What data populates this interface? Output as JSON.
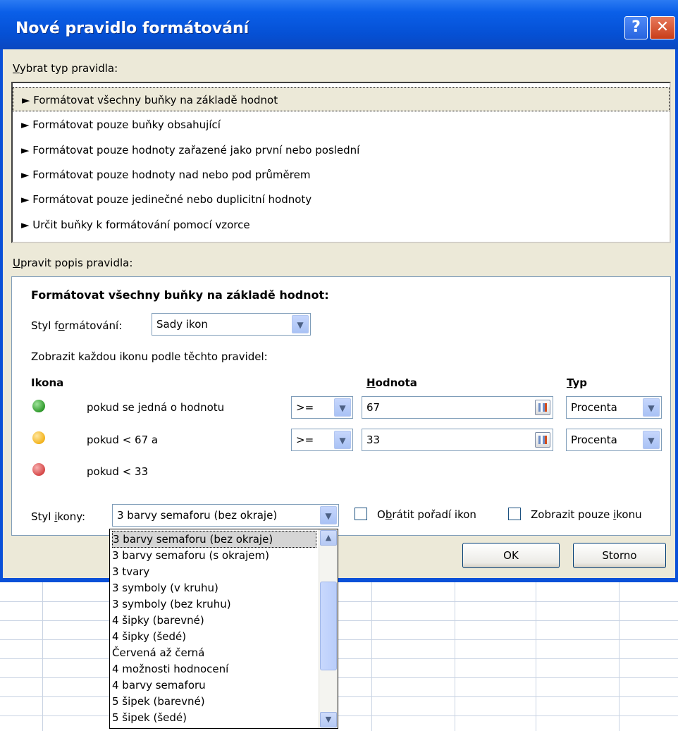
{
  "dialog": {
    "title": "Nové pravidlo formátování",
    "help_glyph": "?",
    "close_glyph": "✕"
  },
  "rule_type": {
    "label_hotkey": "V",
    "label_rest": "ybrat typ pravidla:",
    "items": [
      {
        "label": "► Formátovat všechny buňky na základě hodnot",
        "selected": true
      },
      {
        "label": "► Formátovat pouze buňky obsahující",
        "selected": false
      },
      {
        "label": "► Formátovat pouze hodnoty zařazené jako první nebo poslední",
        "selected": false
      },
      {
        "label": "► Formátovat pouze hodnoty nad nebo pod průměrem",
        "selected": false
      },
      {
        "label": "► Formátovat pouze jedinečné nebo duplicitní hodnoty",
        "selected": false
      },
      {
        "label": "► Určit buňky k formátování pomocí vzorce",
        "selected": false
      }
    ]
  },
  "rule_description": {
    "label_hotkey": "U",
    "label_rest": "pravit popis pravidla:",
    "heading": "Formátovat všechny buňky na základě hodnot:",
    "format_style_label_a": "Styl f",
    "format_style_label_hotkey": "o",
    "format_style_label_b": "rmátování:",
    "format_style_value": "Sady ikon",
    "show_each_icon": "Zobrazit každou ikonu podle těchto pravidel:",
    "col_icon": "Ikona",
    "col_value_hotkey": "H",
    "col_value_rest": "odnota",
    "col_type_hotkey": "T",
    "col_type_rest": "yp",
    "rows": [
      {
        "icon": "green-circle-icon",
        "color": "#2f9a2b",
        "condition": "pokud se jedná o hodnotu",
        "operator": ">=",
        "value": "67",
        "type": "Procenta"
      },
      {
        "icon": "yellow-circle-icon",
        "color": "#f3b31c",
        "condition": "pokud < 67 a",
        "operator": ">=",
        "value": "33",
        "type": "Procenta"
      },
      {
        "icon": "red-circle-icon",
        "color": "#d64848",
        "condition": "pokud < 33"
      }
    ],
    "icon_style_label_a": "Styl ",
    "icon_style_label_hotkey": "i",
    "icon_style_label_b": "kony:",
    "icon_style_value": "3 barvy semaforu (bez okraje)",
    "reverse_label_a": "O",
    "reverse_label_hotkey": "b",
    "reverse_label_b": "rátit pořadí ikon",
    "reverse_checked": false,
    "show_icon_only_label_a": "Zobrazit pouze ",
    "show_icon_only_label_hotkey": "i",
    "show_icon_only_label_b": "konu",
    "show_icon_only_checked": false
  },
  "buttons": {
    "ok": "OK",
    "cancel": "Storno"
  },
  "icon_style_dropdown": {
    "options": [
      "3 barvy semaforu (bez okraje)",
      "3 barvy semaforu (s okrajem)",
      "3 tvary",
      "3 symboly (v kruhu)",
      "3 symboly (bez kruhu)",
      "4 šipky (barevné)",
      "4 šipky (šedé)",
      "Červená až černá",
      "4 možnosti hodnocení",
      "4 barvy semaforu",
      "5 šipek (barevné)",
      "5 šipek (šedé)"
    ],
    "selected_index": 0
  },
  "colors": {
    "title_bar": "#0a5fe8",
    "dialog_face": "#ece9d8",
    "selection": "#d5d5d5"
  }
}
